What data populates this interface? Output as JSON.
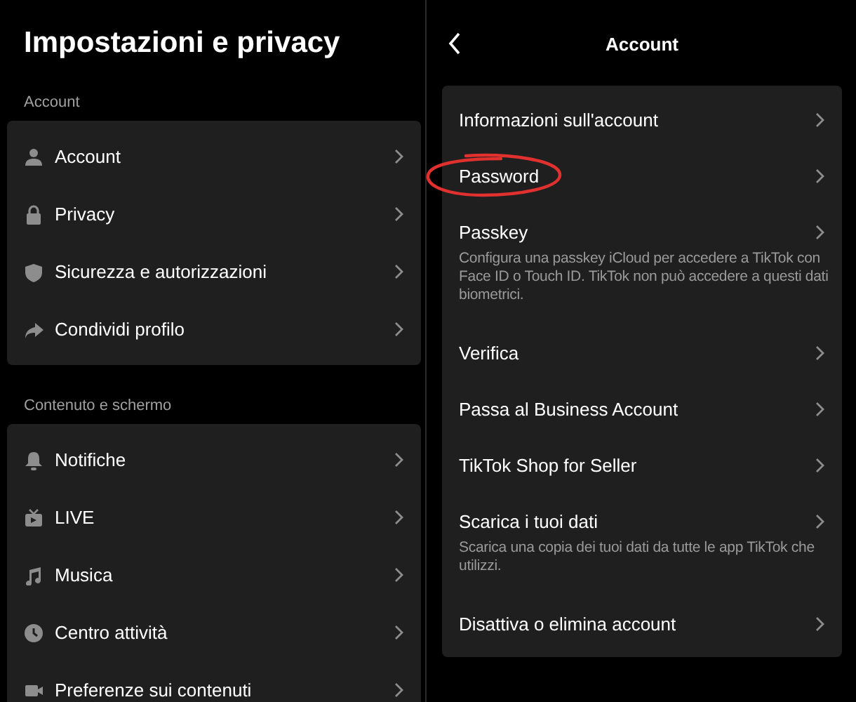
{
  "settings_panel": {
    "title": "Impostazioni e privacy",
    "sections": [
      {
        "label": "Account",
        "items": [
          {
            "label": "Account"
          },
          {
            "label": "Privacy"
          },
          {
            "label": "Sicurezza e autorizzazioni"
          },
          {
            "label": "Condividi profilo"
          }
        ]
      },
      {
        "label": "Contenuto e schermo",
        "items": [
          {
            "label": "Notifiche"
          },
          {
            "label": "LIVE"
          },
          {
            "label": "Musica"
          },
          {
            "label": "Centro attività"
          },
          {
            "label": "Preferenze sui contenuti"
          }
        ]
      }
    ]
  },
  "account_panel": {
    "title": "Account",
    "items": [
      {
        "label": "Informazioni sull'account",
        "circled": false
      },
      {
        "label": "Password",
        "circled": true
      },
      {
        "label": "Passkey",
        "description": "Configura una passkey iCloud per accedere a TikTok con Face ID o Touch ID. TikTok non può accedere a questi dati biometrici.",
        "circled": false
      },
      {
        "label": "Verifica",
        "circled": false
      },
      {
        "label": "Passa al Business Account",
        "circled": false
      },
      {
        "label": "TikTok Shop for Seller",
        "circled": false
      },
      {
        "label": "Scarica i tuoi dati",
        "description": "Scarica una copia dei tuoi dati da tutte le app TikTok che utilizzi.",
        "circled": false
      },
      {
        "label": "Disattiva o elimina account",
        "circled": false
      }
    ]
  }
}
